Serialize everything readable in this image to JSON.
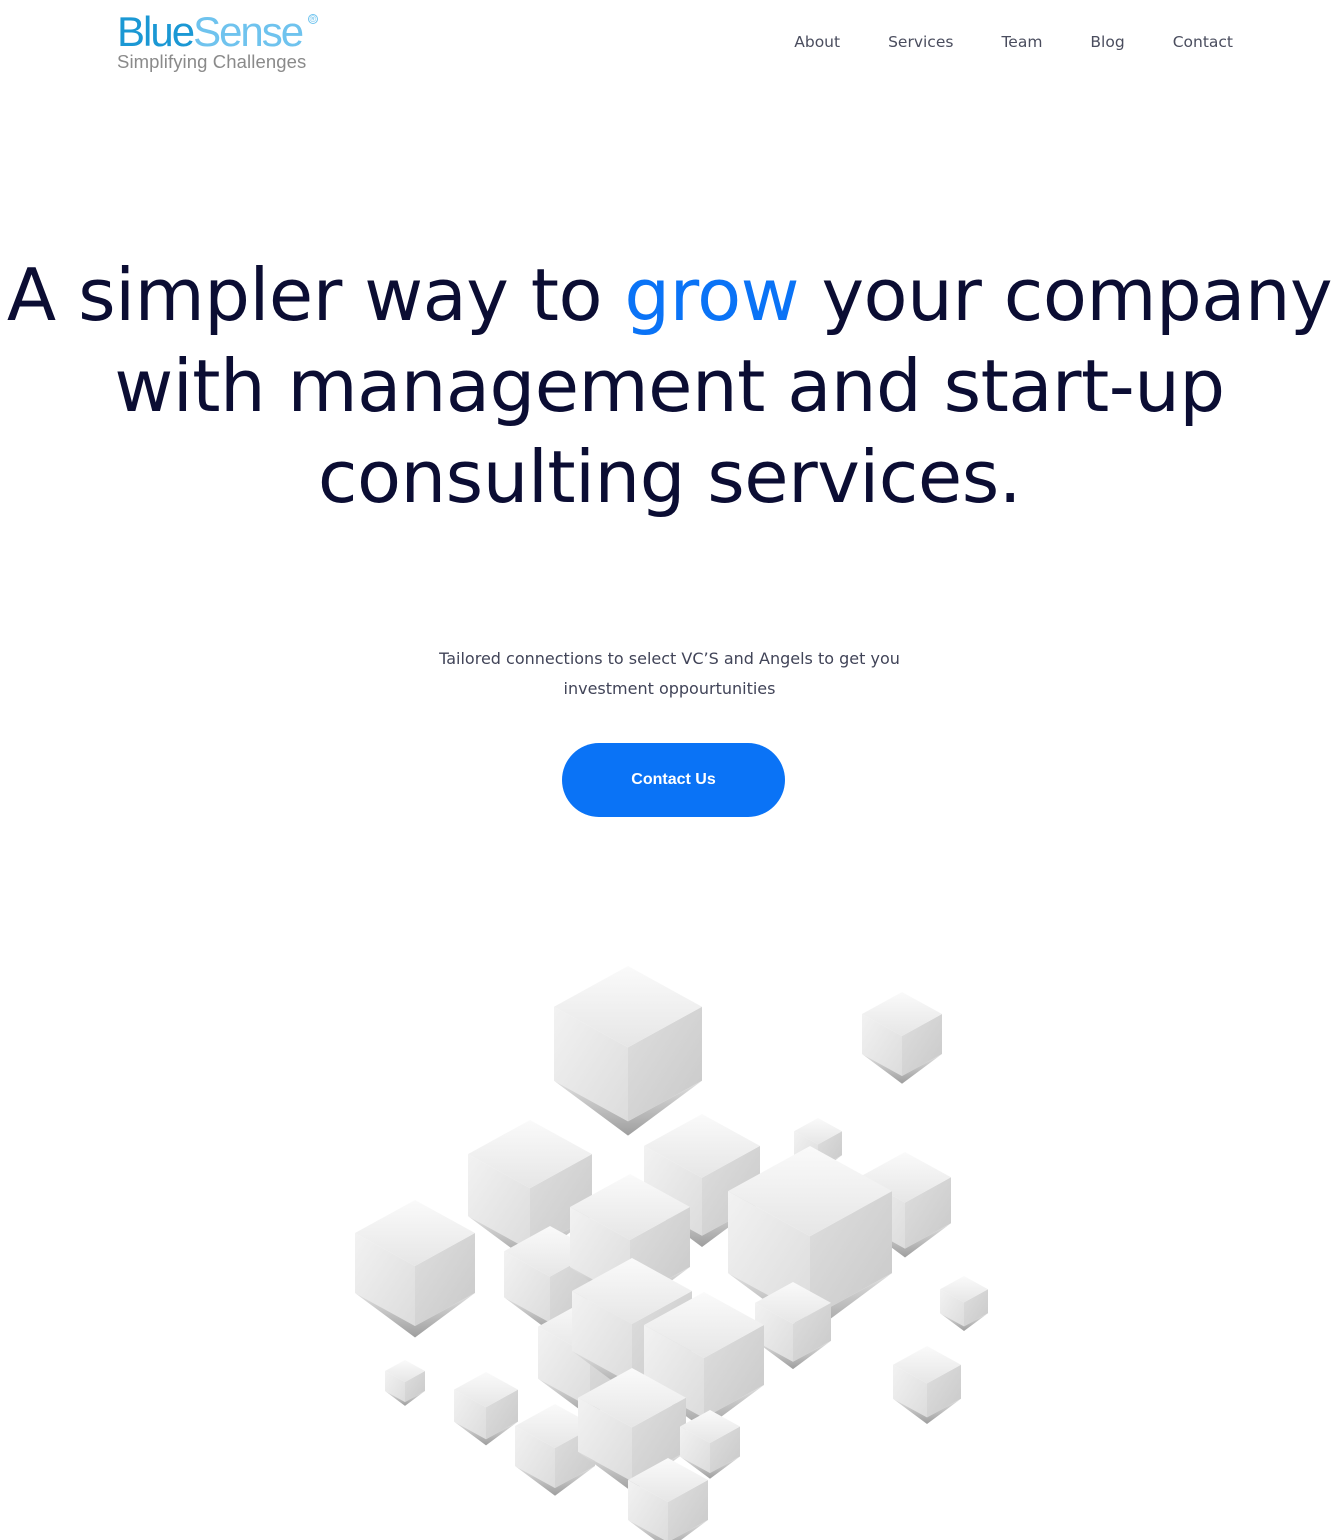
{
  "header": {
    "logo": {
      "part1": "Blue",
      "part2": "Sense",
      "registered": "®",
      "tagline": "Simplifying Challenges"
    },
    "nav": [
      {
        "label": "About"
      },
      {
        "label": "Services"
      },
      {
        "label": "Team"
      },
      {
        "label": "Blog"
      },
      {
        "label": "Contact"
      }
    ]
  },
  "hero": {
    "title_before": "A simpler way to ",
    "title_accent": "grow",
    "title_after": " your company with management and start-up consulting services.",
    "subtitle_line1": "Tailored connections to select VC’S and Angels to get you",
    "subtitle_line2": "investment oppourtunities",
    "cta_label": "Contact Us"
  },
  "colors": {
    "accent": "#0a73f6",
    "heading": "#0b0d33",
    "logo_blue": "#1b98d4",
    "logo_light": "#6fc3ee"
  },
  "illustration": {
    "icon": "floating-cubes-illustration"
  }
}
